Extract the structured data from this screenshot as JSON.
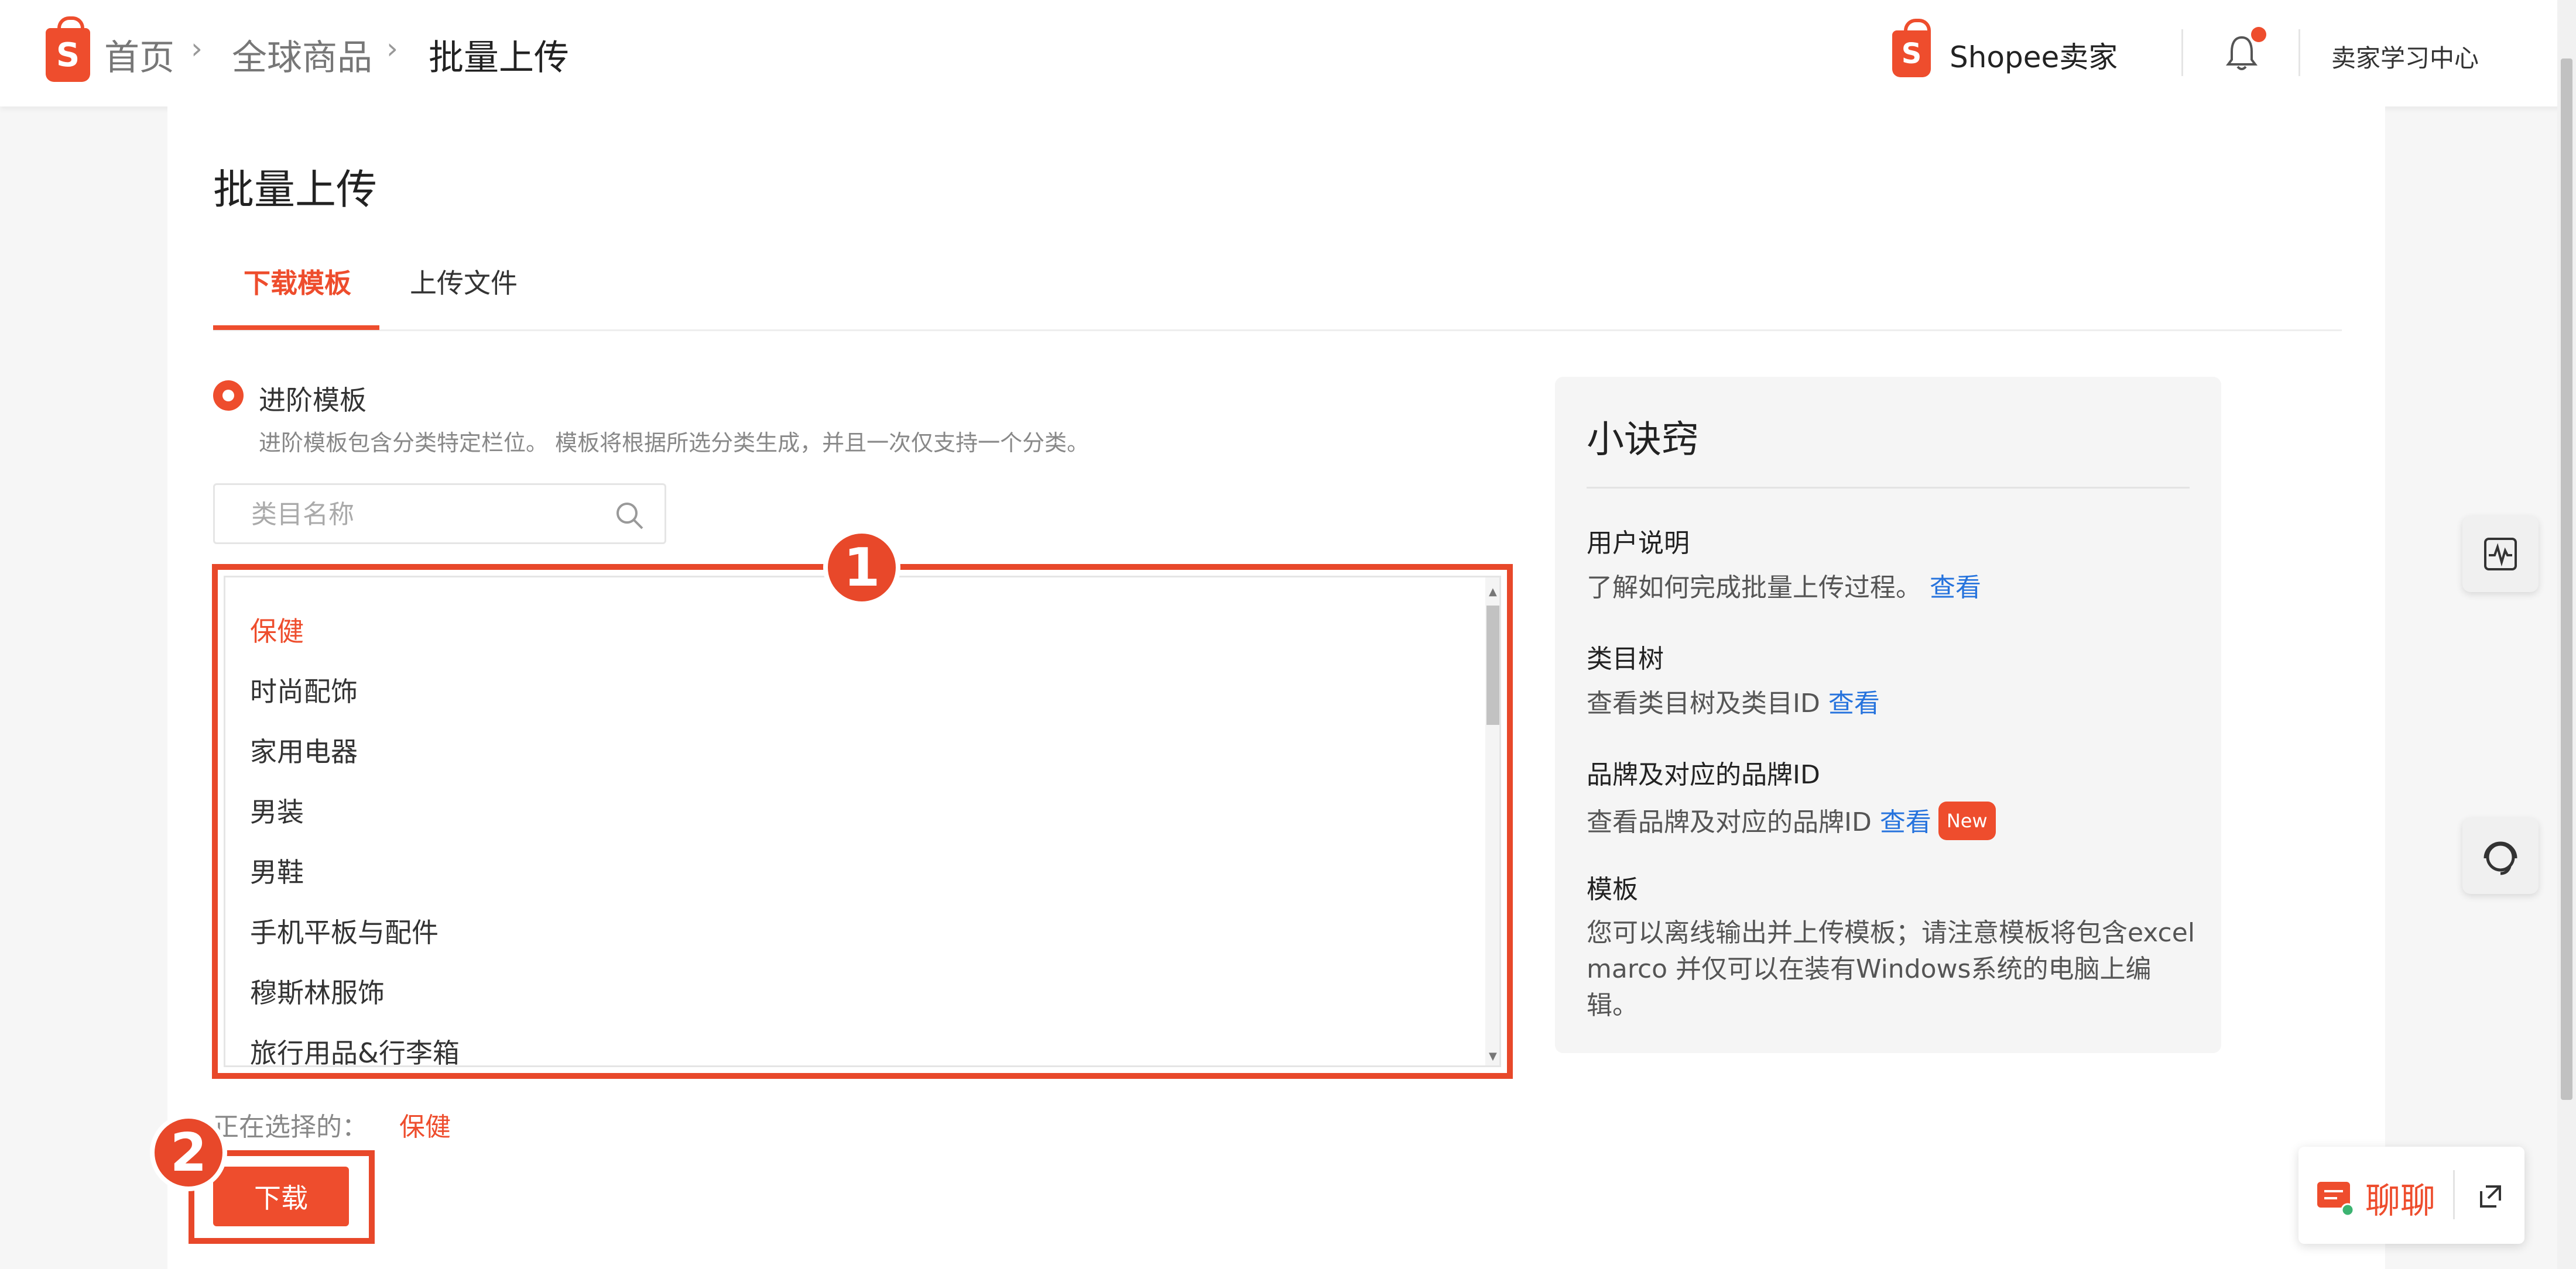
{
  "header": {
    "breadcrumb": [
      "首页",
      "全球商品",
      "批量上传"
    ],
    "brand": "Shopee卖家",
    "learning_center": "卖家学习中心",
    "logo_letter": "S"
  },
  "page": {
    "title": "批量上传"
  },
  "tabs": [
    {
      "label": "下载模板",
      "active": true
    },
    {
      "label": "上传文件",
      "active": false
    }
  ],
  "template_option": {
    "label": "进阶模板",
    "description": "进阶模板包含分类特定栏位。 模板将根据所选分类生成，并且一次仅支持一个分类。"
  },
  "search": {
    "placeholder": "类目名称",
    "value": ""
  },
  "categories": [
    {
      "label": "保健",
      "selected": true
    },
    {
      "label": "时尚配饰",
      "selected": false
    },
    {
      "label": "家用电器",
      "selected": false
    },
    {
      "label": "男装",
      "selected": false
    },
    {
      "label": "男鞋",
      "selected": false
    },
    {
      "label": "手机平板与配件",
      "selected": false
    },
    {
      "label": "穆斯林服饰",
      "selected": false
    },
    {
      "label": "旅行用品&行李箱",
      "selected": false
    }
  ],
  "annotations": [
    "1",
    "2"
  ],
  "selection": {
    "label": "正在选择的：",
    "value": "保健"
  },
  "download_button": "下载",
  "tips": {
    "title": "小诀窍",
    "sections": [
      {
        "heading": "用户说明",
        "text": "了解如何完成批量上传过程。",
        "link": "查看"
      },
      {
        "heading": "类目树",
        "text": "查看类目树及类目ID",
        "link": "查看"
      },
      {
        "heading": "品牌及对应的品牌ID",
        "text": "查看品牌及对应的品牌ID",
        "link": "查看",
        "badge": "New"
      },
      {
        "heading": "模板",
        "text": "您可以离线输出并上传模板；请注意模板将包含excel marco 并仅可以在装有Windows系统的电脑上编辑。"
      }
    ]
  },
  "chat": {
    "label": "聊聊"
  },
  "colors": {
    "accent": "#ee4d2d",
    "link": "#2673dd",
    "annotation": "#e8482a"
  }
}
